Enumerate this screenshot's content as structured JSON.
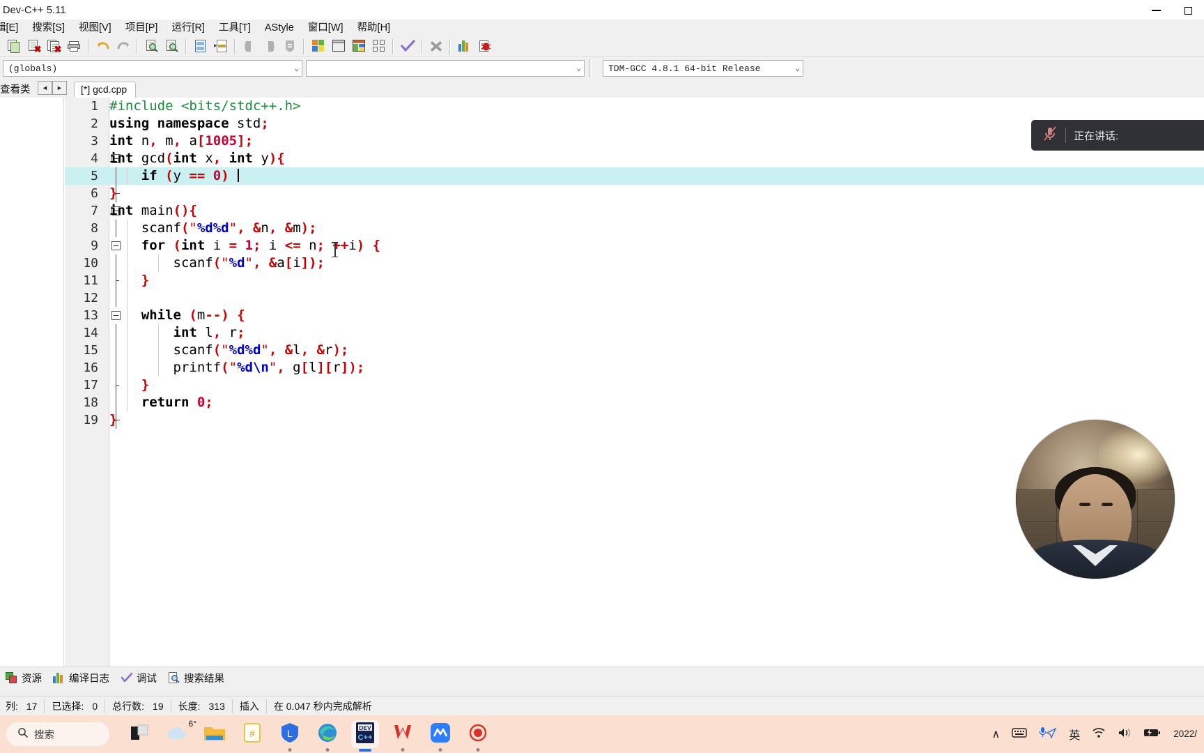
{
  "window": {
    "title": "Dev-C++ 5.11",
    "minimize_label": "minimize",
    "maximize_label": "maximize"
  },
  "menubar": {
    "items": [
      {
        "label": "辑[E]"
      },
      {
        "label": "搜索[S]"
      },
      {
        "label": "视图[V]"
      },
      {
        "label": "项目[P]"
      },
      {
        "label": "运行[R]"
      },
      {
        "label": "工具[T]"
      },
      {
        "label": "AStyle"
      },
      {
        "label": "窗口[W]"
      },
      {
        "label": "帮助[H]"
      }
    ]
  },
  "toolbar": {
    "buttons": [
      {
        "name": "new-file-icon",
        "title": "新建"
      },
      {
        "name": "close-file-icon",
        "title": "关闭"
      },
      {
        "name": "close-all-icon",
        "title": "全部关闭"
      },
      {
        "name": "print-icon",
        "title": "打印"
      },
      {
        "name": "undo-icon",
        "title": "撤销"
      },
      {
        "name": "redo-icon",
        "title": "重做"
      },
      {
        "name": "find-icon",
        "title": "查找"
      },
      {
        "name": "find-next-icon",
        "title": "查找下一个"
      },
      {
        "name": "replace-icon",
        "title": "替换"
      },
      {
        "name": "goto-line-icon",
        "title": "转到行"
      },
      {
        "name": "back-icon",
        "title": "后退"
      },
      {
        "name": "forward-icon",
        "title": "前进"
      },
      {
        "name": "profile-icon",
        "title": "配置"
      },
      {
        "name": "compile-icon",
        "title": "编译"
      },
      {
        "name": "run-icon",
        "title": "运行"
      },
      {
        "name": "compile-run-icon",
        "title": "编译运行"
      },
      {
        "name": "rebuild-icon",
        "title": "全部重新编译"
      },
      {
        "name": "syntax-check-icon",
        "title": "语法检查"
      },
      {
        "name": "stop-icon",
        "title": "停止"
      },
      {
        "name": "profiling-icon",
        "title": "性能分析"
      },
      {
        "name": "debug-icon",
        "title": "调试"
      }
    ]
  },
  "selectors": {
    "scope": {
      "value": "(globals)",
      "placeholder": "(globals)"
    },
    "symbol": {
      "value": "",
      "placeholder": ""
    },
    "compiler": {
      "value": "TDM-GCC 4.8.1 64-bit Release"
    }
  },
  "tabrow": {
    "left_panel_label": "查看类",
    "nav_prev": "◄",
    "nav_next": "►",
    "file_tab": "[*] gcd.cpp"
  },
  "editor": {
    "lines": [
      {
        "no": "1",
        "fold": "",
        "indent": 0,
        "tokens": [
          {
            "t": "#include <bits/stdc++.h>",
            "c": "pp"
          }
        ]
      },
      {
        "no": "2",
        "fold": "",
        "indent": 0,
        "tokens": [
          {
            "t": "using namespace ",
            "c": "k"
          },
          {
            "t": "std",
            "c": "id"
          },
          {
            "t": ";",
            "c": "sy"
          }
        ]
      },
      {
        "no": "3",
        "fold": "",
        "indent": 0,
        "tokens": [
          {
            "t": "int ",
            "c": "k"
          },
          {
            "t": "n",
            "c": "id"
          },
          {
            "t": ", ",
            "c": "sy"
          },
          {
            "t": "m",
            "c": "id"
          },
          {
            "t": ", ",
            "c": "sy"
          },
          {
            "t": "a",
            "c": "id"
          },
          {
            "t": "[",
            "c": "sy"
          },
          {
            "t": "1005",
            "c": "num"
          },
          {
            "t": "];",
            "c": "sy"
          }
        ]
      },
      {
        "no": "4",
        "fold": "box",
        "indent": 0,
        "tokens": [
          {
            "t": "int ",
            "c": "k"
          },
          {
            "t": "gcd",
            "c": "id"
          },
          {
            "t": "(",
            "c": "sy"
          },
          {
            "t": "int ",
            "c": "k"
          },
          {
            "t": "x",
            "c": "id"
          },
          {
            "t": ", ",
            "c": "sy"
          },
          {
            "t": "int ",
            "c": "k"
          },
          {
            "t": "y",
            "c": "id"
          },
          {
            "t": "){",
            "c": "sy"
          }
        ]
      },
      {
        "no": "5",
        "fold": "line",
        "indent": 1,
        "highlight": true,
        "caret": true,
        "tokens": [
          {
            "t": "    ",
            "c": "id"
          },
          {
            "t": "if ",
            "c": "k"
          },
          {
            "t": "(",
            "c": "sy"
          },
          {
            "t": "y ",
            "c": "id"
          },
          {
            "t": "== ",
            "c": "sy"
          },
          {
            "t": "0",
            "c": "num"
          },
          {
            "t": ") ",
            "c": "sy"
          }
        ]
      },
      {
        "no": "6",
        "fold": "end",
        "indent": 0,
        "tokens": [
          {
            "t": "}",
            "c": "sy"
          }
        ]
      },
      {
        "no": "7",
        "fold": "box",
        "indent": 0,
        "tokens": [
          {
            "t": "int ",
            "c": "k"
          },
          {
            "t": "main",
            "c": "id"
          },
          {
            "t": "(){",
            "c": "sy"
          }
        ]
      },
      {
        "no": "8",
        "fold": "line",
        "indent": 1,
        "tokens": [
          {
            "t": "    scanf",
            "c": "id"
          },
          {
            "t": "(",
            "c": "sy"
          },
          {
            "t": "\"",
            "c": "st"
          },
          {
            "t": "%d%d",
            "c": "es"
          },
          {
            "t": "\"",
            "c": "st"
          },
          {
            "t": ", ",
            "c": "sy"
          },
          {
            "t": "&",
            "c": "sy"
          },
          {
            "t": "n",
            "c": "id"
          },
          {
            "t": ", ",
            "c": "sy"
          },
          {
            "t": "&",
            "c": "sy"
          },
          {
            "t": "m",
            "c": "id"
          },
          {
            "t": ");",
            "c": "sy"
          }
        ]
      },
      {
        "no": "9",
        "fold": "box",
        "indent": 1,
        "tokens": [
          {
            "t": "    ",
            "c": "id"
          },
          {
            "t": "for ",
            "c": "k"
          },
          {
            "t": "(",
            "c": "sy"
          },
          {
            "t": "int ",
            "c": "k"
          },
          {
            "t": "i ",
            "c": "id"
          },
          {
            "t": "= ",
            "c": "sy"
          },
          {
            "t": "1",
            "c": "num"
          },
          {
            "t": "; ",
            "c": "sy"
          },
          {
            "t": "i ",
            "c": "id"
          },
          {
            "t": "<= ",
            "c": "sy"
          },
          {
            "t": "n",
            "c": "id"
          },
          {
            "t": "; ",
            "c": "sy"
          },
          {
            "t": "++",
            "c": "sy"
          },
          {
            "t": "i",
            "c": "id"
          },
          {
            "t": ") {",
            "c": "sy"
          }
        ]
      },
      {
        "no": "10",
        "fold": "line",
        "indent": 2,
        "tokens": [
          {
            "t": "        scanf",
            "c": "id"
          },
          {
            "t": "(",
            "c": "sy"
          },
          {
            "t": "\"",
            "c": "st"
          },
          {
            "t": "%d",
            "c": "es"
          },
          {
            "t": "\"",
            "c": "st"
          },
          {
            "t": ", ",
            "c": "sy"
          },
          {
            "t": "&",
            "c": "sy"
          },
          {
            "t": "a",
            "c": "id"
          },
          {
            "t": "[",
            "c": "sy"
          },
          {
            "t": "i",
            "c": "id"
          },
          {
            "t": "]);",
            "c": "sy"
          }
        ]
      },
      {
        "no": "11",
        "fold": "tick",
        "indent": 1,
        "tokens": [
          {
            "t": "    ",
            "c": "id"
          },
          {
            "t": "}",
            "c": "sy"
          }
        ]
      },
      {
        "no": "12",
        "fold": "line",
        "indent": 1,
        "tokens": [
          {
            "t": "",
            "c": "id"
          }
        ]
      },
      {
        "no": "13",
        "fold": "box",
        "indent": 1,
        "tokens": [
          {
            "t": "    ",
            "c": "id"
          },
          {
            "t": "while ",
            "c": "k"
          },
          {
            "t": "(",
            "c": "sy"
          },
          {
            "t": "m",
            "c": "id"
          },
          {
            "t": "--",
            "c": "sy"
          },
          {
            "t": ") {",
            "c": "sy"
          }
        ]
      },
      {
        "no": "14",
        "fold": "line",
        "indent": 2,
        "tokens": [
          {
            "t": "        ",
            "c": "id"
          },
          {
            "t": "int ",
            "c": "k"
          },
          {
            "t": "l",
            "c": "id"
          },
          {
            "t": ", ",
            "c": "sy"
          },
          {
            "t": "r",
            "c": "id"
          },
          {
            "t": ";",
            "c": "sy"
          }
        ]
      },
      {
        "no": "15",
        "fold": "line",
        "indent": 2,
        "tokens": [
          {
            "t": "        scanf",
            "c": "id"
          },
          {
            "t": "(",
            "c": "sy"
          },
          {
            "t": "\"",
            "c": "st"
          },
          {
            "t": "%d%d",
            "c": "es"
          },
          {
            "t": "\"",
            "c": "st"
          },
          {
            "t": ", ",
            "c": "sy"
          },
          {
            "t": "&",
            "c": "sy"
          },
          {
            "t": "l",
            "c": "id"
          },
          {
            "t": ", ",
            "c": "sy"
          },
          {
            "t": "&",
            "c": "sy"
          },
          {
            "t": "r",
            "c": "id"
          },
          {
            "t": ");",
            "c": "sy"
          }
        ]
      },
      {
        "no": "16",
        "fold": "line",
        "indent": 2,
        "tokens": [
          {
            "t": "        printf",
            "c": "id"
          },
          {
            "t": "(",
            "c": "sy"
          },
          {
            "t": "\"",
            "c": "st"
          },
          {
            "t": "%d\\n",
            "c": "es"
          },
          {
            "t": "\"",
            "c": "st"
          },
          {
            "t": ", ",
            "c": "sy"
          },
          {
            "t": "g",
            "c": "id"
          },
          {
            "t": "[",
            "c": "sy"
          },
          {
            "t": "l",
            "c": "id"
          },
          {
            "t": "][",
            "c": "sy"
          },
          {
            "t": "r",
            "c": "id"
          },
          {
            "t": "]);",
            "c": "sy"
          }
        ]
      },
      {
        "no": "17",
        "fold": "tick",
        "indent": 1,
        "tokens": [
          {
            "t": "    ",
            "c": "id"
          },
          {
            "t": "}",
            "c": "sy"
          }
        ]
      },
      {
        "no": "18",
        "fold": "line",
        "indent": 1,
        "tokens": [
          {
            "t": "    ",
            "c": "id"
          },
          {
            "t": "return ",
            "c": "k"
          },
          {
            "t": "0",
            "c": "num"
          },
          {
            "t": ";",
            "c": "sy"
          }
        ]
      },
      {
        "no": "19",
        "fold": "end",
        "indent": 0,
        "tokens": [
          {
            "t": "}",
            "c": "sy"
          }
        ]
      }
    ]
  },
  "overlay": {
    "speaking_label": "正在讲话:",
    "mic_icon": "mic-muted-icon"
  },
  "bottom_panel": {
    "tabs": [
      {
        "label": "资源",
        "icon": "resource-icon"
      },
      {
        "label": "编译日志",
        "icon": "compile-log-icon"
      },
      {
        "label": "调试",
        "icon": "debug-check-icon"
      },
      {
        "label": "搜索结果",
        "icon": "search-results-icon"
      }
    ]
  },
  "status_bar": {
    "cells": [
      {
        "name": "列:",
        "value": "17"
      },
      {
        "name": "已选择:",
        "value": "0"
      },
      {
        "name": "总行数:",
        "value": "19"
      },
      {
        "name": "长度:",
        "value": "313"
      },
      {
        "name": "插入",
        "value": ""
      },
      {
        "name": "在 0.047 秒内完成解析",
        "value": ""
      }
    ]
  },
  "taskbar": {
    "search_label": "搜索",
    "weather_temp": "6°",
    "apps": [
      {
        "name": "task-view",
        "label": "任务视图"
      },
      {
        "name": "weather",
        "label": "天气"
      },
      {
        "name": "file-explorer",
        "label": "文件资源管理器"
      },
      {
        "name": "notes",
        "label": "便笺"
      },
      {
        "name": "lenovo",
        "label": "Lenovo"
      },
      {
        "name": "edge",
        "label": "Microsoft Edge"
      },
      {
        "name": "devcpp",
        "label": "Dev-C++"
      },
      {
        "name": "wps",
        "label": "WPS"
      },
      {
        "name": "meeting",
        "label": "腾讯会议"
      },
      {
        "name": "recorder",
        "label": "录屏"
      }
    ],
    "tray": {
      "chevron": "∧",
      "keyboard": "keyboard-icon",
      "mic": "mic-icon",
      "ime": "英",
      "wifi": "wifi-icon",
      "volume": "volume-icon",
      "battery": "battery-icon",
      "clock": "2022/"
    }
  },
  "colors": {
    "accent": "#2d6fe0",
    "taskbar_bg": "#fbdfd0",
    "selection": "#cbf0f2",
    "string": "#cc0000",
    "keyword": "#000000",
    "preprocessor": "#1f8b3d",
    "number": "#cc0033",
    "escape": "#0000cc"
  }
}
